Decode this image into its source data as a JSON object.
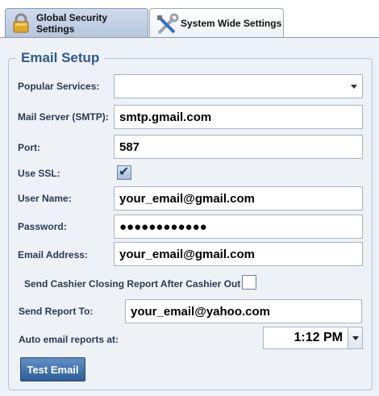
{
  "tabs": [
    {
      "label": "Global Security Settings",
      "icon": "padlock-icon",
      "active": true
    },
    {
      "label": "System Wide Settings",
      "icon": "tools-icon",
      "active": false
    }
  ],
  "section_title": "Email Setup",
  "fields": {
    "popular_services": {
      "label": "Popular Services:",
      "value": ""
    },
    "mail_server": {
      "label": "Mail Server (SMTP):",
      "value": "smtp.gmail.com"
    },
    "port": {
      "label": "Port:",
      "value": "587"
    },
    "use_ssl": {
      "label": "Use SSL:",
      "checked": true
    },
    "user_name": {
      "label": "User Name:",
      "value": "your_email@gmail.com"
    },
    "password": {
      "label": "Password:",
      "value": "●●●●●●●●●●●●"
    },
    "email_address": {
      "label": "Email Address:",
      "value": "your_email@gmail.com"
    },
    "send_cashier_report": {
      "label": "Send Cashier Closing Report After Cashier Out",
      "checked": false
    },
    "send_report_to": {
      "label": "Send Report To:",
      "value": "your_email@yahoo.com"
    },
    "auto_email_time": {
      "label": "Auto email reports at:",
      "value": "1:12 PM"
    }
  },
  "buttons": {
    "test_email": "Test Email"
  },
  "colors": {
    "accent": "#2f5a8a",
    "button": "#2f5e98"
  }
}
